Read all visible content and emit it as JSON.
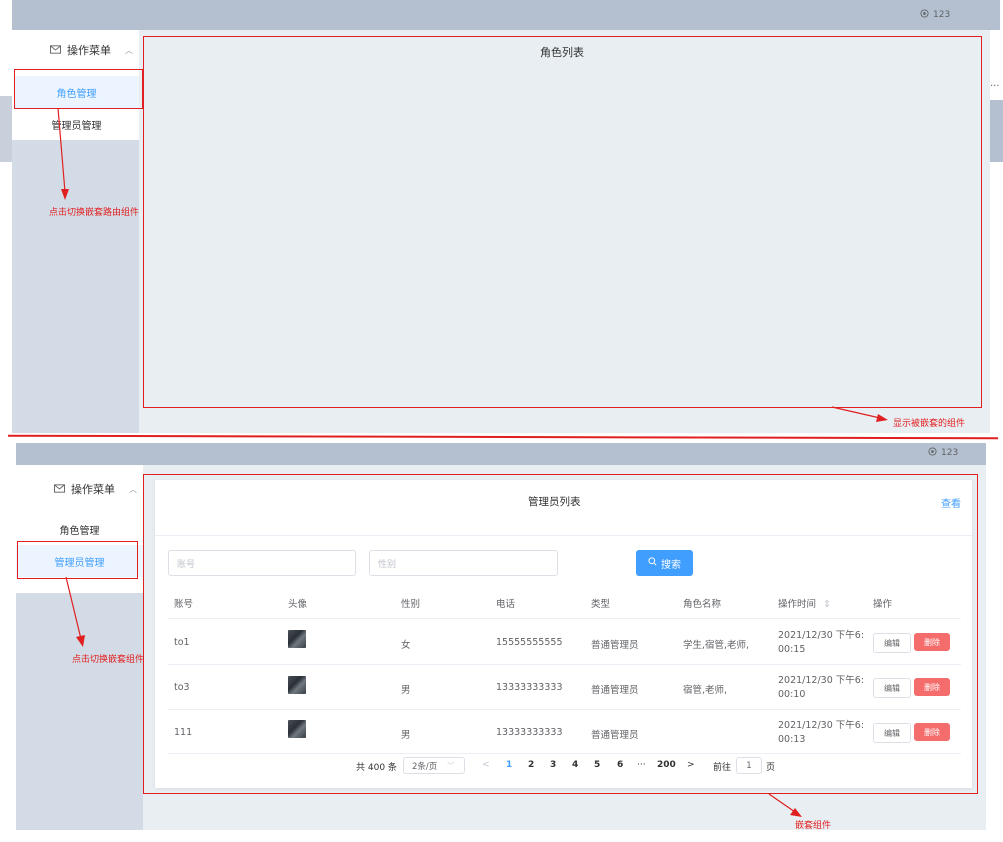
{
  "top": {
    "user_name": "123",
    "menu_title": "操作菜单",
    "menu_items": [
      "角色管理",
      "管理员管理"
    ],
    "content_title": "角色列表",
    "annotation_left": "点击切换嵌套路由组件",
    "annotation_right": "显示被嵌套的组件",
    "ellipsis": "..."
  },
  "bottom": {
    "user_name": "123",
    "menu_title": "操作菜单",
    "menu_items": [
      "角色管理",
      "管理员管理"
    ],
    "card_title": "管理员列表",
    "card_link": "查看",
    "filters": {
      "account_placeholder": "账号",
      "gender_placeholder": "性别"
    },
    "search_label": "搜索",
    "columns": [
      "账号",
      "头像",
      "性别",
      "电话",
      "类型",
      "角色名称",
      "操作时间",
      "操作"
    ],
    "sort_icon": "⇕",
    "rows": [
      {
        "account": "to1",
        "gender": "女",
        "phone": "15555555555",
        "type": "普通管理员",
        "roles": "学生,宿管,老师,",
        "time1": "2021/12/30 下午6:",
        "time2": "00:15"
      },
      {
        "account": "to3",
        "gender": "男",
        "phone": "13333333333",
        "type": "普通管理员",
        "roles": "宿管,老师,",
        "time1": "2021/12/30 下午6:",
        "time2": "00:10"
      },
      {
        "account": "111",
        "gender": "男",
        "phone": "13333333333",
        "type": "普通管理员",
        "roles": "",
        "time1": "2021/12/30 下午6:",
        "time2": "00:13"
      }
    ],
    "edit_label": "编辑",
    "delete_label": "删除",
    "pagination": {
      "total": "共 400 条",
      "page_size": "2条/页",
      "prev": "<",
      "pages": [
        "1",
        "2",
        "3",
        "4",
        "5",
        "6"
      ],
      "more": "···",
      "last": "200",
      "next": ">",
      "goto_label": "前往",
      "goto_value": "1",
      "page_unit": "页"
    },
    "annotation_left": "点击切换嵌套组件",
    "annotation_bottom": "嵌套组件"
  },
  "colors": {
    "accent": "#409eff",
    "danger": "#f56c6c",
    "annotation": "#e02020"
  }
}
